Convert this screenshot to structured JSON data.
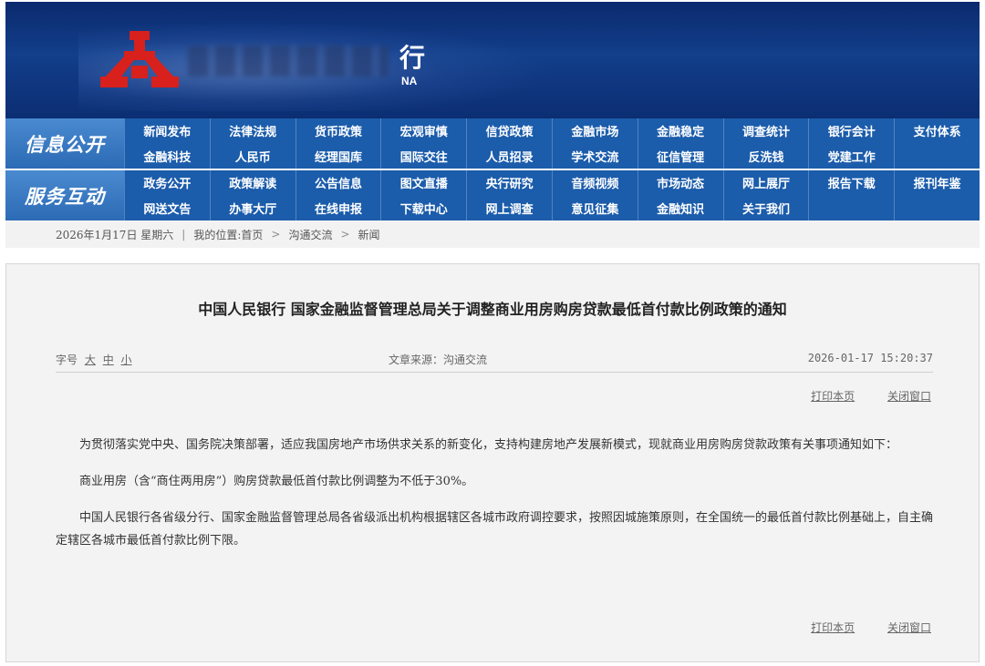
{
  "banner": {
    "bank_char": "行",
    "bank_en": "NA",
    "colors": {
      "bg": "#123e8a",
      "logo": "#d8201c"
    }
  },
  "nav": {
    "group1_label": "信息公开",
    "group1_items": [
      "新闻发布",
      "法律法规",
      "货币政策",
      "宏观审慎",
      "信贷政策",
      "金融市场",
      "金融稳定",
      "调查统计",
      "银行会计",
      "支付体系",
      "金融科技",
      "人民币",
      "经理国库",
      "国际交往",
      "人员招录",
      "学术交流",
      "征信管理",
      "反洗钱",
      "党建工作",
      ""
    ],
    "group2_label": "服务互动",
    "group2_items": [
      "政务公开",
      "政策解读",
      "公告信息",
      "图文直播",
      "央行研究",
      "音频视频",
      "市场动态",
      "网上展厅",
      "报告下载",
      "报刊年鉴",
      "网送文告",
      "办事大厅",
      "在线申报",
      "下载中心",
      "网上调查",
      "意见征集",
      "金融知识",
      "关于我们",
      "",
      ""
    ]
  },
  "breadcrumb": {
    "date": "2026年1月17日 星期六",
    "divider": "|",
    "location_label": "我的位置:",
    "home": "首页",
    "arrow": ">",
    "section": "沟通交流",
    "page": "新闻"
  },
  "article": {
    "title": "中国人民银行 国家金融监督管理总局关于调整商业用房购房贷款最低首付款比例政策的通知",
    "font_size_label": "字号",
    "size_large": "大",
    "size_medium": "中",
    "size_small": "小",
    "source": "文章来源：沟通交流",
    "time": "2026-01-17 15:20:37",
    "print_label": "打印本页",
    "close_label": "关闭窗口",
    "paragraphs": [
      "为贯彻落实党中央、国务院决策部署，适应我国房地产市场供求关系的新变化，支持构建房地产发展新模式，现就商业用房购房贷款政策有关事项通知如下：",
      "商业用房（含“商住两用房”）购房贷款最低首付款比例调整为不低于30%。",
      "中国人民银行各省级分行、国家金融监督管理总局各省级派出机构根据辖区各城市政府调控要求，按照因城施策原则，在全国统一的最低首付款比例基础上，自主确定辖区各城市最低首付款比例下限。"
    ]
  }
}
